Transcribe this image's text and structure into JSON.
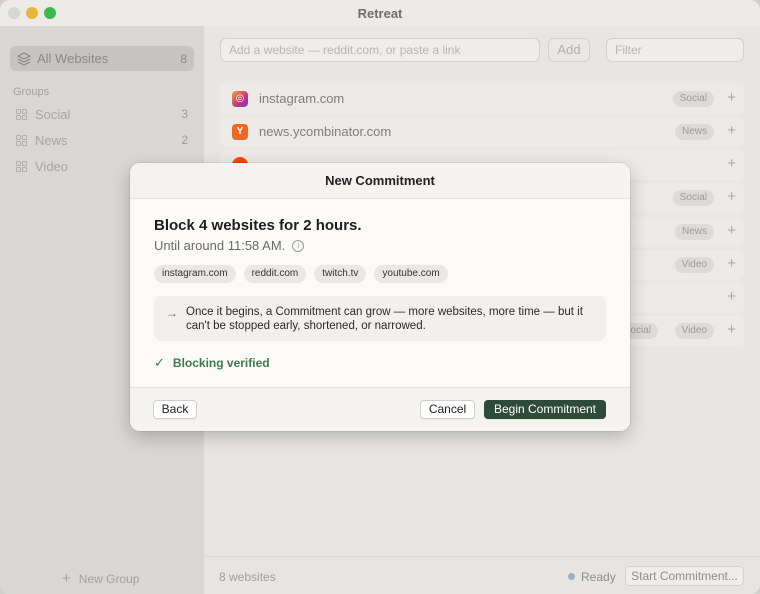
{
  "window": {
    "title": "Retreat"
  },
  "sidebar": {
    "all_websites": {
      "label": "All Websites",
      "count": "8",
      "icon": "layers-icon"
    },
    "groups_header": "Groups",
    "groups": [
      {
        "label": "Social",
        "count": "3",
        "icon": "grid-icon"
      },
      {
        "label": "News",
        "count": "2",
        "icon": "grid-icon"
      },
      {
        "label": "Video",
        "count": "",
        "icon": "grid-icon"
      }
    ],
    "new_group_label": "New Group"
  },
  "main": {
    "add_input_placeholder": "Add a website — reddit.com, or paste a link",
    "add_button_label": "Add",
    "filter_placeholder": "Filter",
    "sites": [
      {
        "name": "instagram.com",
        "tag": "Social",
        "icon": "instagram-icon"
      },
      {
        "name": "news.ycombinator.com",
        "tag": "News",
        "icon": "ycombinator-icon"
      },
      {
        "name": "",
        "tag": "",
        "icon": "reddit-icon"
      },
      {
        "name": "",
        "tag": "Social",
        "icon": ""
      },
      {
        "name": "",
        "tag": "News",
        "icon": ""
      },
      {
        "name": "",
        "tag": "Video",
        "icon": ""
      },
      {
        "name": "",
        "tag": "",
        "icon": ""
      },
      {
        "name": "",
        "tag": "Video",
        "tag_secondary": "ocial",
        "icon": ""
      }
    ]
  },
  "footer": {
    "count_label": "8 websites",
    "status_label": "Ready",
    "start_button_label": "Start Commitment..."
  },
  "dialog": {
    "header": "New Commitment",
    "title": "Block 4 websites for 2 hours.",
    "subtitle": "Until around 11:58 AM.",
    "chips": [
      "instagram.com",
      "reddit.com",
      "twitch.tv",
      "youtube.com"
    ],
    "note": "Once it begins, a Commitment can grow — more websites, more time — but it can't be stopped early, shortened, or narrowed.",
    "verified_label": "Blocking verified",
    "back_label": "Back",
    "cancel_label": "Cancel",
    "begin_label": "Begin Commitment"
  },
  "colors": {
    "accent_dark_green": "#2e4a39",
    "verified_green": "#3e7a4c",
    "instagram": "#c13584",
    "ycombinator": "#f26522",
    "reddit": "#ff4500"
  }
}
